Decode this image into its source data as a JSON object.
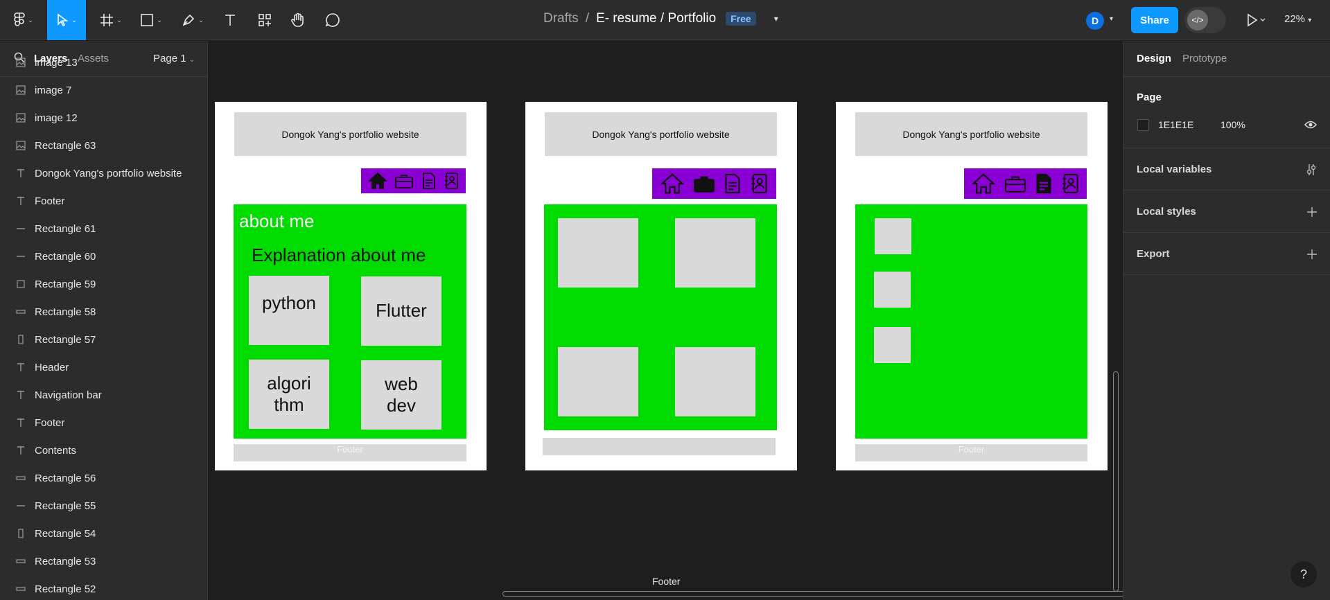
{
  "topbar": {
    "breadcrumb_folder": "Drafts",
    "separator": "/",
    "file_title": "E- resume / Portfolio",
    "plan_badge": "Free",
    "avatar_initial": "D",
    "share_label": "Share",
    "zoom": "22%"
  },
  "left_panel": {
    "tab_layers": "Layers",
    "tab_assets": "Assets",
    "page_selector": "Page 1",
    "layers": [
      {
        "name": "image 13",
        "icon": "image-icon"
      },
      {
        "name": "image 7",
        "icon": "image-icon"
      },
      {
        "name": "image 12",
        "icon": "image-icon"
      },
      {
        "name": "Rectangle 63",
        "icon": "image-icon"
      },
      {
        "name": "Dongok Yang's portfolio website",
        "icon": "text-icon"
      },
      {
        "name": "Footer",
        "icon": "text-icon"
      },
      {
        "name": "Rectangle 61",
        "icon": "line-icon"
      },
      {
        "name": "Rectangle 60",
        "icon": "line-icon"
      },
      {
        "name": "Rectangle 59",
        "icon": "rectangle-icon"
      },
      {
        "name": "Rectangle 58",
        "icon": "wide-rectangle-icon"
      },
      {
        "name": "Rectangle 57",
        "icon": "tall-rectangle-icon"
      },
      {
        "name": "Header",
        "icon": "text-icon"
      },
      {
        "name": "Navigation bar",
        "icon": "text-icon"
      },
      {
        "name": "Footer",
        "icon": "text-icon"
      },
      {
        "name": "Contents",
        "icon": "text-icon"
      },
      {
        "name": "Rectangle 56",
        "icon": "wide-rectangle-icon"
      },
      {
        "name": "Rectangle 55",
        "icon": "line-icon"
      },
      {
        "name": "Rectangle 54",
        "icon": "tall-rectangle-icon"
      },
      {
        "name": "Rectangle 53",
        "icon": "wide-rectangle-icon"
      },
      {
        "name": "Rectangle 52",
        "icon": "wide-rectangle-icon"
      }
    ]
  },
  "canvas": {
    "frame1": {
      "header": "Dongok Yang's portfolio website",
      "about_title": "about me",
      "explanation": "Explanation about me",
      "box1": "python",
      "box2": "Flutter",
      "box3_line1": "algori",
      "box3_line2": "thm",
      "box4_line1": "web",
      "box4_line2": "dev",
      "footer": "Footer"
    },
    "frame2": {
      "header": "Dongok Yang's portfolio website"
    },
    "frame3": {
      "header": "Dongok Yang's portfolio website",
      "footer": "Footer"
    },
    "bottom_label": "Footer"
  },
  "right_panel": {
    "tab_design": "Design",
    "tab_prototype": "Prototype",
    "page_section": "Page",
    "page_color_hex": "1E1E1E",
    "page_opacity": "100%",
    "local_variables": "Local variables",
    "local_styles": "Local styles",
    "export": "Export"
  },
  "colors": {
    "accent": "#0d99ff",
    "nav_purple": "#8a00d4",
    "content_green": "#00dc00",
    "placeholder_gray": "#d9d9d9",
    "canvas_bg": "#1e1e1e"
  }
}
